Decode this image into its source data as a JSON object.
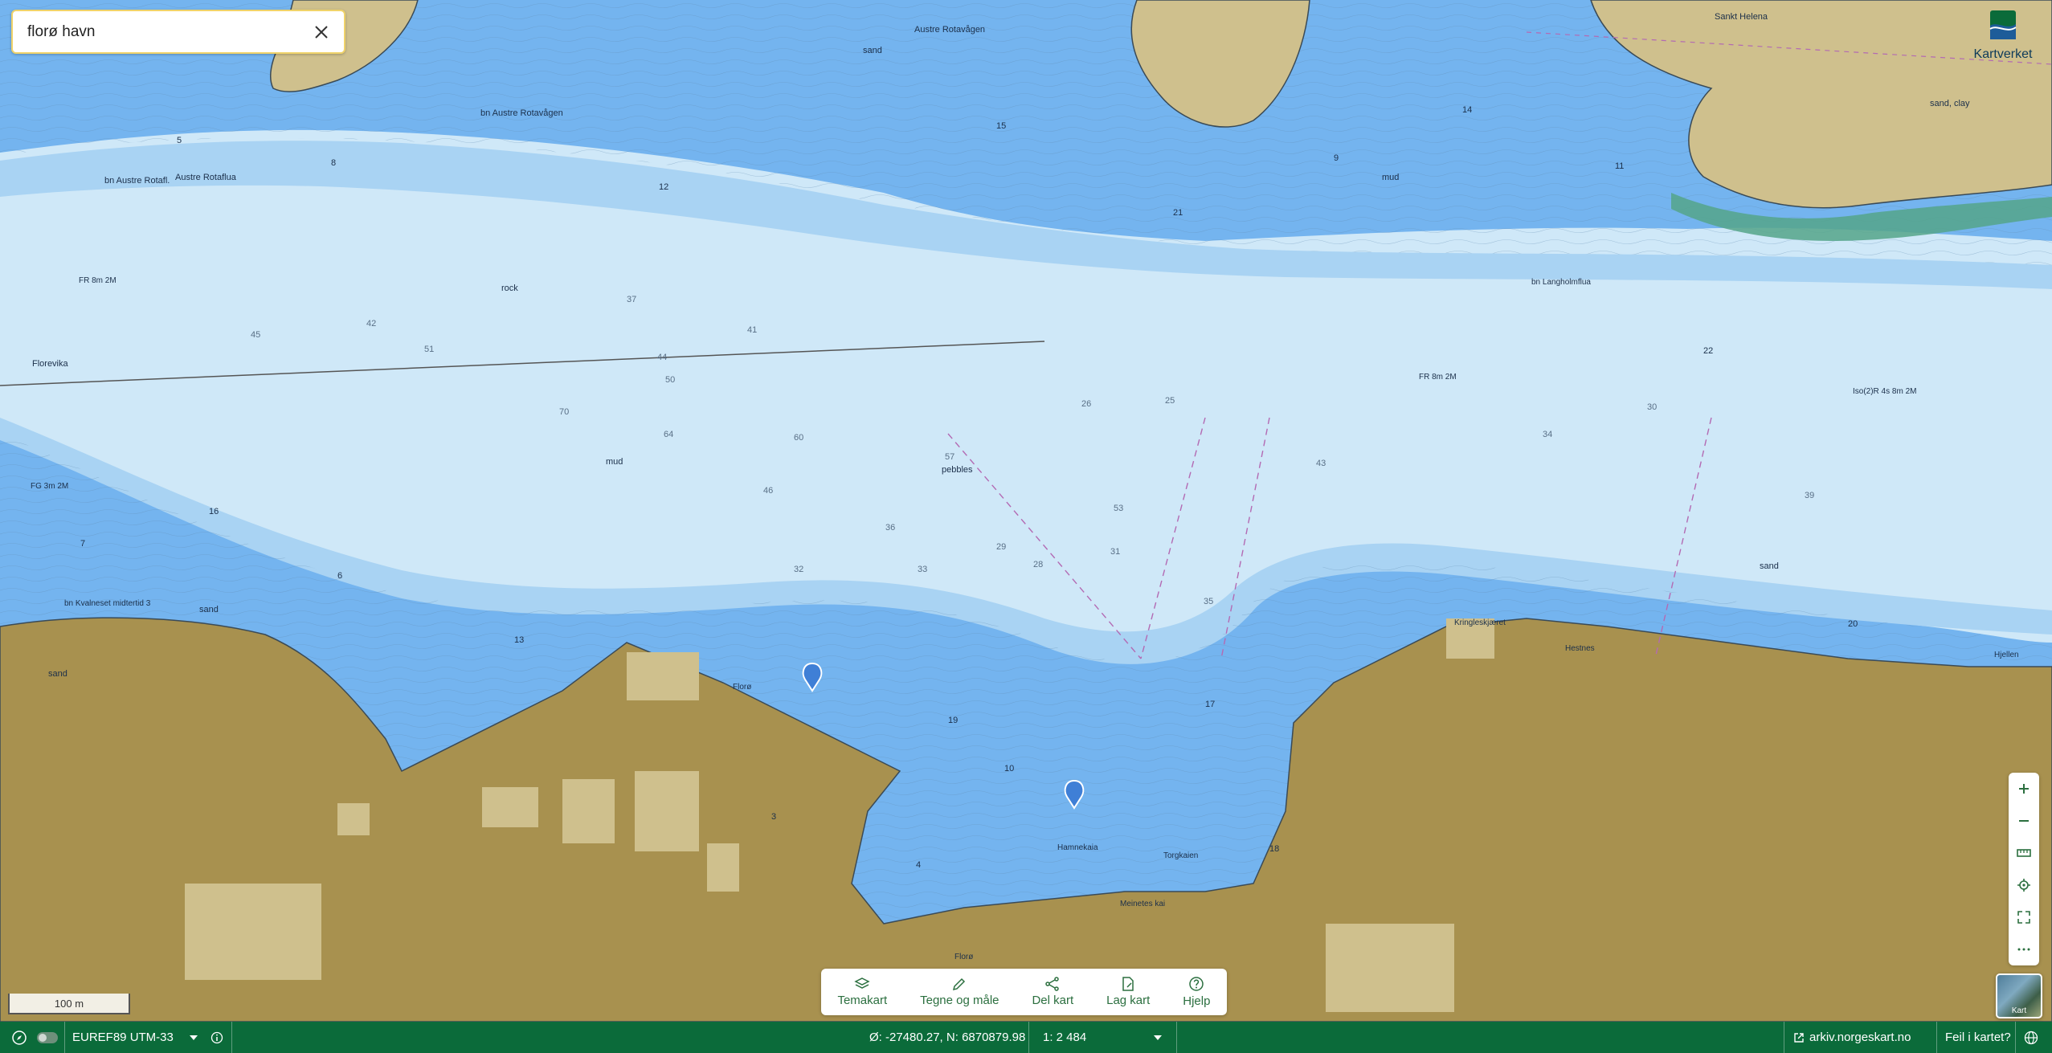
{
  "search": {
    "value": "florø havn",
    "placeholder": ""
  },
  "logo": {
    "text": "Kartverket"
  },
  "map_labels": {
    "sankt_helena": "Sankt Helena",
    "austre_rotavagen": "Austre Rotavågen",
    "bn_austre_rotavagen": "bn Austre Rotavågen",
    "bn_austre_rotafl": "bn Austre Rotafl.",
    "austre_rotaflua": "Austre Rotaflua",
    "florevika": "Florevika",
    "rock": "rock",
    "mud": "mud",
    "mud2": "mud",
    "pebbles": "pebbles",
    "sand": "sand",
    "sand2": "sand",
    "sand3": "sand",
    "sand4": "sand",
    "sand_clay": "sand, clay",
    "fr_8m_2m_left": "FR 8m 2M",
    "fg_3m_2m": "FG 3m 2M",
    "fr_8m_2m_right": "FR 8m 2M",
    "iso_lights": "Iso(2)R 4s 8m 2M",
    "bn_langholmflua": "bn Langholmflua",
    "kvalneset": "bn Kvalneset midtertid 3",
    "floro": "Florø",
    "flora": "Florø",
    "hamnekaia": "Hamnekaia",
    "torgkaien": "Torgkaien",
    "meineteskai": "Meinetes kai",
    "kringleskjaeret": "Kringleskjæret",
    "hestnes": "Hestnes",
    "hjellen": "Hjellen"
  },
  "depths_shallow": [
    "5",
    "8",
    "12",
    "15",
    "21",
    "9",
    "14",
    "11",
    "7",
    "16",
    "6",
    "13",
    "19",
    "10",
    "17",
    "20",
    "4",
    "18",
    "22",
    "3"
  ],
  "depths_deep": [
    "42",
    "45",
    "51",
    "37",
    "41",
    "44",
    "50",
    "70",
    "64",
    "60",
    "57",
    "46",
    "53",
    "36",
    "33",
    "32",
    "31",
    "35",
    "43",
    "34",
    "30",
    "39",
    "29",
    "28",
    "26",
    "25"
  ],
  "scale_bar": {
    "label": "100 m"
  },
  "toolbar": {
    "temakart": "Temakart",
    "tegne": "Tegne og måle",
    "del": "Del kart",
    "lag": "Lag kart",
    "hjelp": "Hjelp"
  },
  "basemap": {
    "label": "Kart"
  },
  "status": {
    "crs": "EUREF89 UTM-33",
    "coords": "Ø: -27480.27, N: 6870879.98",
    "scale": "1: 2 484",
    "link": "arkiv.norgeskart.no",
    "error": "Feil i kartet?"
  },
  "colors": {
    "deep_water": "#cfe8f8",
    "mid_water": "#a9d3f3",
    "shallow_water": "#74b4ef",
    "land": "#cfc08d",
    "urban": "#a8914f",
    "status_bar": "#0b6b3a",
    "accent_green": "#2b6f3f"
  }
}
